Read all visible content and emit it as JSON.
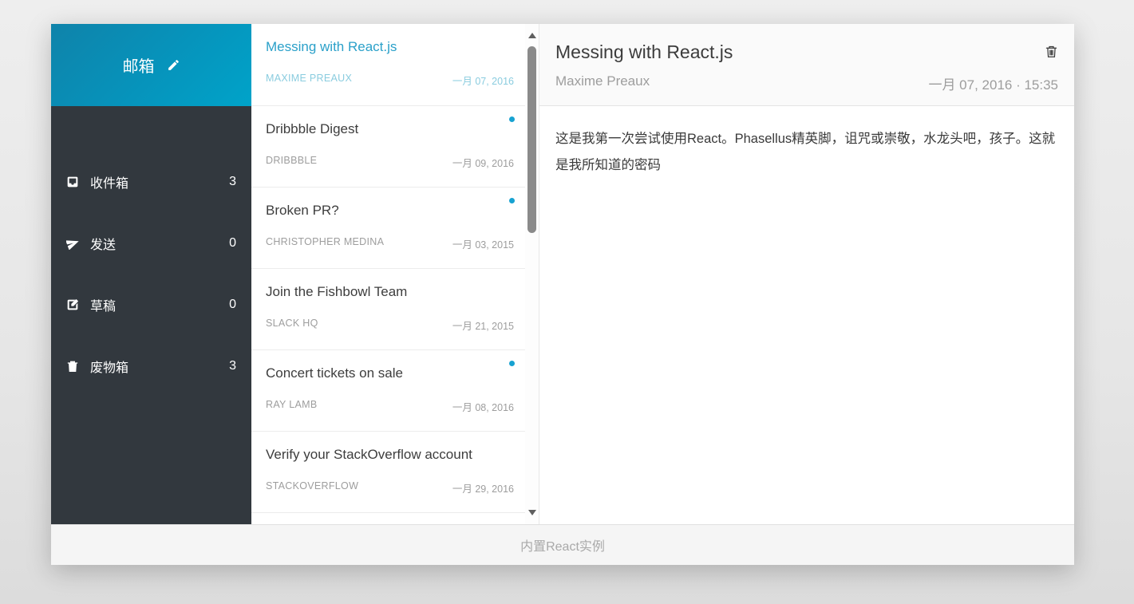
{
  "colors": {
    "accent_gradient_start": "#0f83aa",
    "accent_gradient_end": "#00a3c9",
    "sidebar_bg": "#32383e",
    "selected_subject": "#2aa0c9",
    "selected_meta": "#8accdf",
    "unread_dot": "#17a2d1",
    "muted_text": "#9d9d9d",
    "footer_bg": "#f5f5f5"
  },
  "sidebar": {
    "title": "邮箱",
    "compose_icon": "pencil-icon",
    "items": [
      {
        "label": "收件箱",
        "count": "3",
        "icon": "inbox-icon"
      },
      {
        "label": "发送",
        "count": "0",
        "icon": "paper-plane-icon"
      },
      {
        "label": "草稿",
        "count": "0",
        "icon": "edit-icon"
      },
      {
        "label": "废物箱",
        "count": "3",
        "icon": "trash-icon"
      }
    ]
  },
  "email_list": [
    {
      "subject": "Messing with React.js",
      "sender": "MAXIME PREAUX",
      "date": "一月 07, 2016",
      "selected": true,
      "unread": false
    },
    {
      "subject": "Dribbble Digest",
      "sender": "DRIBBBLE",
      "date": "一月 09, 2016",
      "selected": false,
      "unread": true
    },
    {
      "subject": "Broken PR?",
      "sender": "CHRISTOPHER MEDINA",
      "date": "一月 03, 2015",
      "selected": false,
      "unread": true
    },
    {
      "subject": "Join the Fishbowl Team",
      "sender": "SLACK HQ",
      "date": "一月 21, 2015",
      "selected": false,
      "unread": false
    },
    {
      "subject": "Concert tickets on sale",
      "sender": "RAY LAMB",
      "date": "一月 08, 2016",
      "selected": false,
      "unread": true
    },
    {
      "subject": "Verify your StackOverflow account",
      "sender": "STACKOVERFLOW",
      "date": "一月 29, 2016",
      "selected": false,
      "unread": false
    }
  ],
  "detail": {
    "subject": "Messing with React.js",
    "sender": "Maxime Preaux",
    "datetime": "一月 07, 2016 · 15:35",
    "body": "这是我第一次尝试使用React。Phasellus精英脚，诅咒或崇敬，水龙头吧，孩子。这就是我所知道的密码"
  },
  "footer": {
    "text": "内置React实例"
  }
}
